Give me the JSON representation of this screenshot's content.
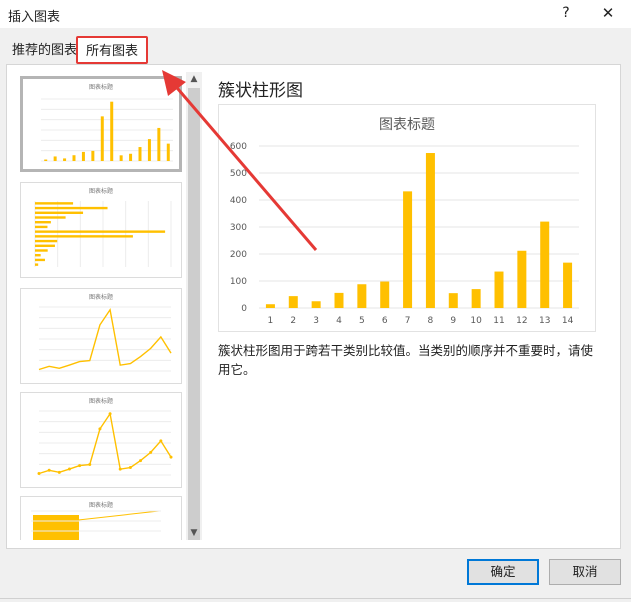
{
  "dialog": {
    "title": "插入图表",
    "help": "?",
    "close": "✕"
  },
  "tabs": [
    {
      "label": "推荐的图表"
    },
    {
      "label": "所有图表"
    }
  ],
  "thumbnails": [
    {
      "title": "图表标题",
      "type": "column",
      "selected": true
    },
    {
      "title": "图表标题",
      "type": "bar"
    },
    {
      "title": "图表标题",
      "type": "line"
    },
    {
      "title": "图表标题",
      "type": "line-markers"
    },
    {
      "title": "图表标题",
      "type": "combo"
    }
  ],
  "scrollbar": {
    "up": "▲",
    "down": "▼"
  },
  "preview": {
    "type_name": "簇状柱形图",
    "description": "簇状柱形图用于跨若干类别比较值。当类别的顺序并不重要时，请使用它。"
  },
  "chart_data": {
    "type": "bar",
    "title": "图表标题",
    "categories": [
      "1",
      "2",
      "3",
      "4",
      "5",
      "6",
      "7",
      "8",
      "9",
      "10",
      "11",
      "12",
      "13",
      "14"
    ],
    "values": [
      14,
      44,
      25,
      56,
      88,
      98,
      432,
      574,
      55,
      70,
      135,
      212,
      320,
      168
    ],
    "ylim": [
      0,
      600
    ],
    "yticks": [
      0,
      100,
      200,
      300,
      400,
      500,
      600
    ],
    "ytick_labels": [
      "0",
      "100",
      "200",
      "300",
      "400",
      "500",
      "600"
    ],
    "grid": true,
    "bar_color": "#ffc000"
  },
  "buttons": {
    "ok": "确定",
    "cancel": "取消"
  },
  "colors": {
    "accent": "#0078d7",
    "highlight": "#e53935",
    "bar": "#ffc000"
  }
}
